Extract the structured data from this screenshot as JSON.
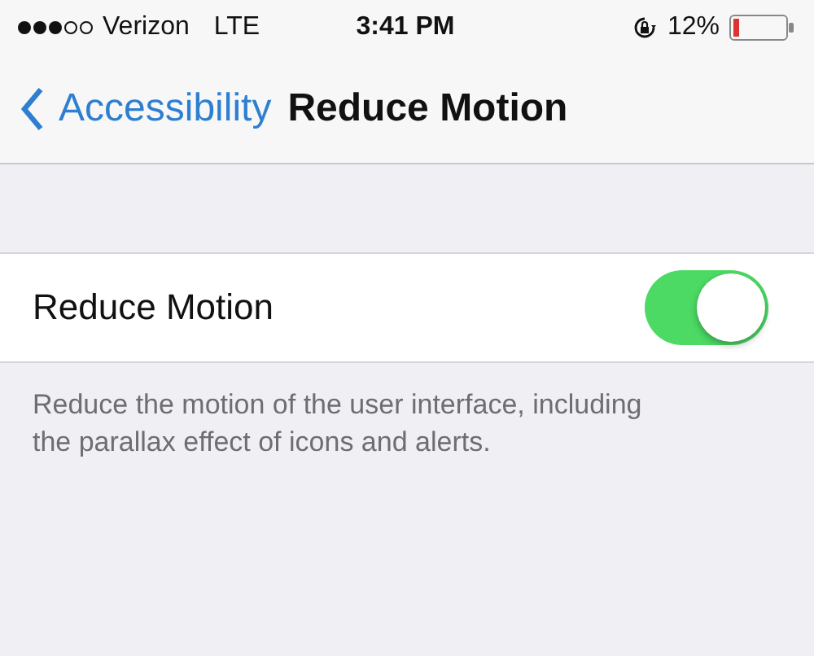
{
  "status_bar": {
    "carrier": "Verizon",
    "network": "LTE",
    "time": "3:41 PM",
    "battery_percent": "12%"
  },
  "nav_bar": {
    "back_label": "Accessibility",
    "title": "Reduce Motion"
  },
  "settings": [
    {
      "label": "Reduce Motion",
      "kind": "toggle",
      "on": true
    }
  ],
  "footer": "Reduce the motion of the user interface, including the parallax effect of icons and alerts."
}
